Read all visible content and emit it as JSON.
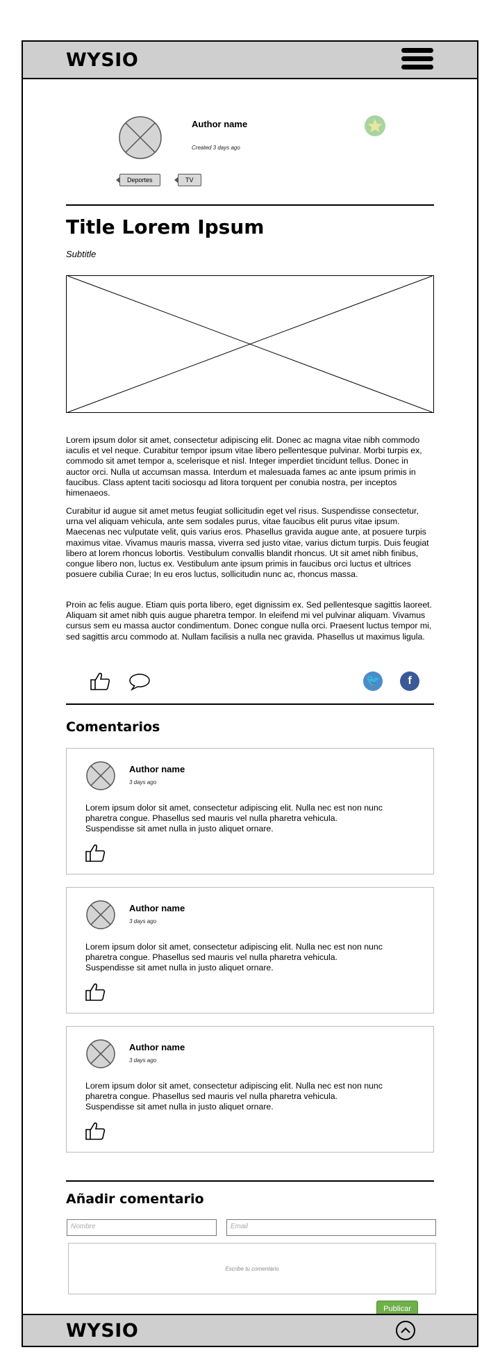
{
  "header": {
    "logo": "WYSIO"
  },
  "author": {
    "name": "Author name",
    "created": "Created 3 days ago"
  },
  "tags": [
    "Deportes",
    "TV"
  ],
  "article": {
    "title": "Title Lorem Ipsum",
    "subtitle": "Subtitle",
    "paragraphs": [
      "Lorem ipsum dolor sit amet, consectetur adipiscing elit. Donec ac magna vitae nibh commodo iaculis et vel neque. Curabitur tempor ipsum vitae libero pellentesque pulvinar. Morbi turpis ex, commodo sit amet tempor a, scelerisque et nisl. Integer imperdiet tincidunt tellus. Donec in auctor orci. Nulla ut accumsan massa. Interdum et malesuada fames ac ante ipsum primis in faucibus.  Class aptent taciti sociosqu ad litora torquent per conubia nostra, per inceptos himenaeos.",
      "Curabitur id augue sit amet metus feugiat sollicitudin eget vel risus. Suspendisse consectetur, urna vel aliquam vehicula, ante sem sodales purus, vitae faucibus elit purus vitae ipsum. Maecenas nec vulputate velit, quis varius eros. Phasellus gravida augue ante, at posuere turpis maximus vitae. Vivamus mauris massa, viverra sed justo vitae, varius dictum turpis. Duis feugiat libero at lorem rhoncus lobortis. Vestibulum convallis blandit rhoncus. Ut sit amet nibh finibus, congue libero non, luctus ex. Vestibulum ante ipsum primis in faucibus orci luctus et ultrices posuere cubilia Curae; In eu eros luctus, sollicitudin nunc ac, rhoncus massa.",
      "Proin ac felis augue. Etiam quis porta libero, eget dignissim ex.  Sed pellentesque sagittis laoreet. Aliquam sit amet nibh quis augue pharetra tempor. In eleifend mi vel pulvinar aliquam. Vivamus cursus sem eu massa auctor condimentum. Donec congue nulla orci. Praesent luctus tempor mi, sed sagittis arcu commodo at. Nullam facilisis a nulla nec gravida. Phasellus ut maximus ligula."
    ]
  },
  "actions": {
    "like_icon": "thumbs-up-icon",
    "comment_icon": "speech-bubble-icon",
    "twitter_glyph": "🐦",
    "facebook_glyph": "f",
    "twitter_color": "#4a8ccc",
    "facebook_color": "#3b5998"
  },
  "comments_section": {
    "title": "Comentarios",
    "items": [
      {
        "name": "Author name",
        "time": "3 days ago",
        "text": "Lorem ipsum dolor sit amet, consectetur adipiscing elit. Nulla nec est non nunc pharetra congue. Phasellus sed mauris vel nulla pharetra vehicula. Suspendisse sit amet nulla in justo aliquet ornare."
      },
      {
        "name": "Author name",
        "time": "3 days ago",
        "text": "Lorem ipsum dolor sit amet, consectetur adipiscing elit. Nulla nec est non nunc pharetra congue. Phasellus sed mauris vel nulla pharetra vehicula. Suspendisse sit amet nulla in justo aliquet ornare."
      },
      {
        "name": "Author name",
        "time": "3 days ago",
        "text": "Lorem ipsum dolor sit amet, consectetur adipiscing elit. Nulla nec est non nunc pharetra congue. Phasellus sed mauris vel nulla pharetra vehicula. Suspendisse sit amet nulla in justo aliquet ornare."
      }
    ]
  },
  "add_comment": {
    "title": "Añadir comentario",
    "name_placeholder": "Nombre",
    "email_placeholder": "Email",
    "text_placeholder": "Escribe tu comentario",
    "publish_label": "Publicar",
    "publish_color": "#6fb04b"
  },
  "footer": {
    "logo": "WYSIO"
  }
}
